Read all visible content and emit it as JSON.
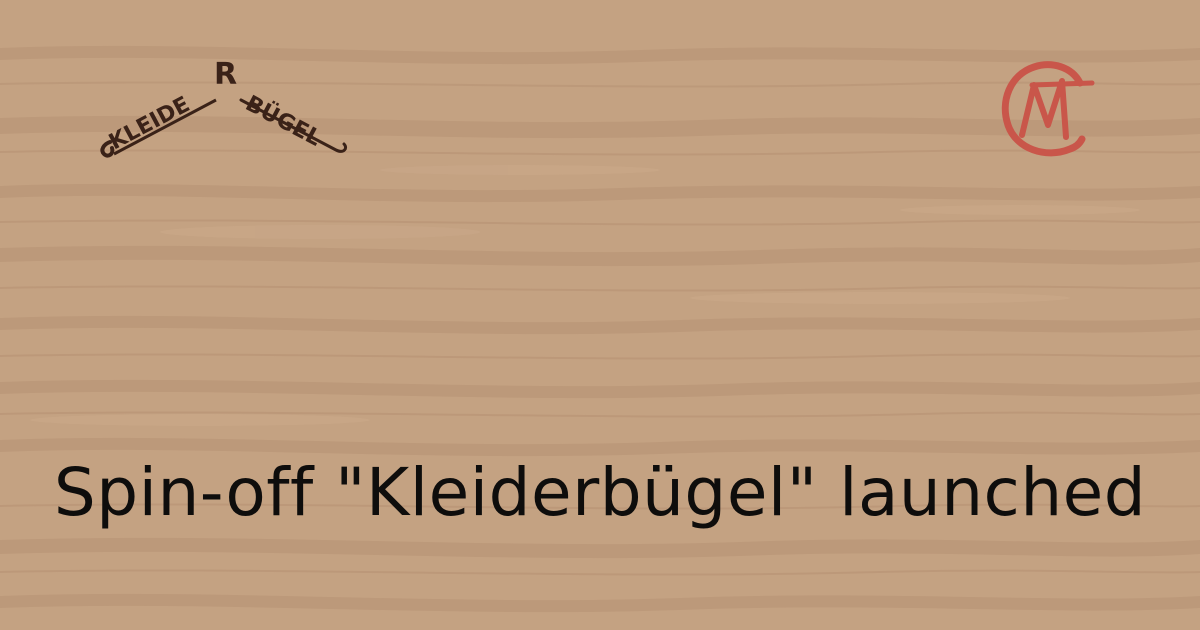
{
  "background": {
    "color": "#c4a282",
    "texture": "wood-grain"
  },
  "logo_left": {
    "brand": "KLEIDERBÜGEL",
    "letters_left": "KLEIDE",
    "letter_peak": "R",
    "letters_right": "BÜGEL",
    "color": "#3a2218"
  },
  "logo_right": {
    "icon": "cm-monogram-icon",
    "color": "#c9564a"
  },
  "headline": {
    "text": "Spin-off \"Kleiderbügel\" launched",
    "color": "#0e0d0c"
  }
}
